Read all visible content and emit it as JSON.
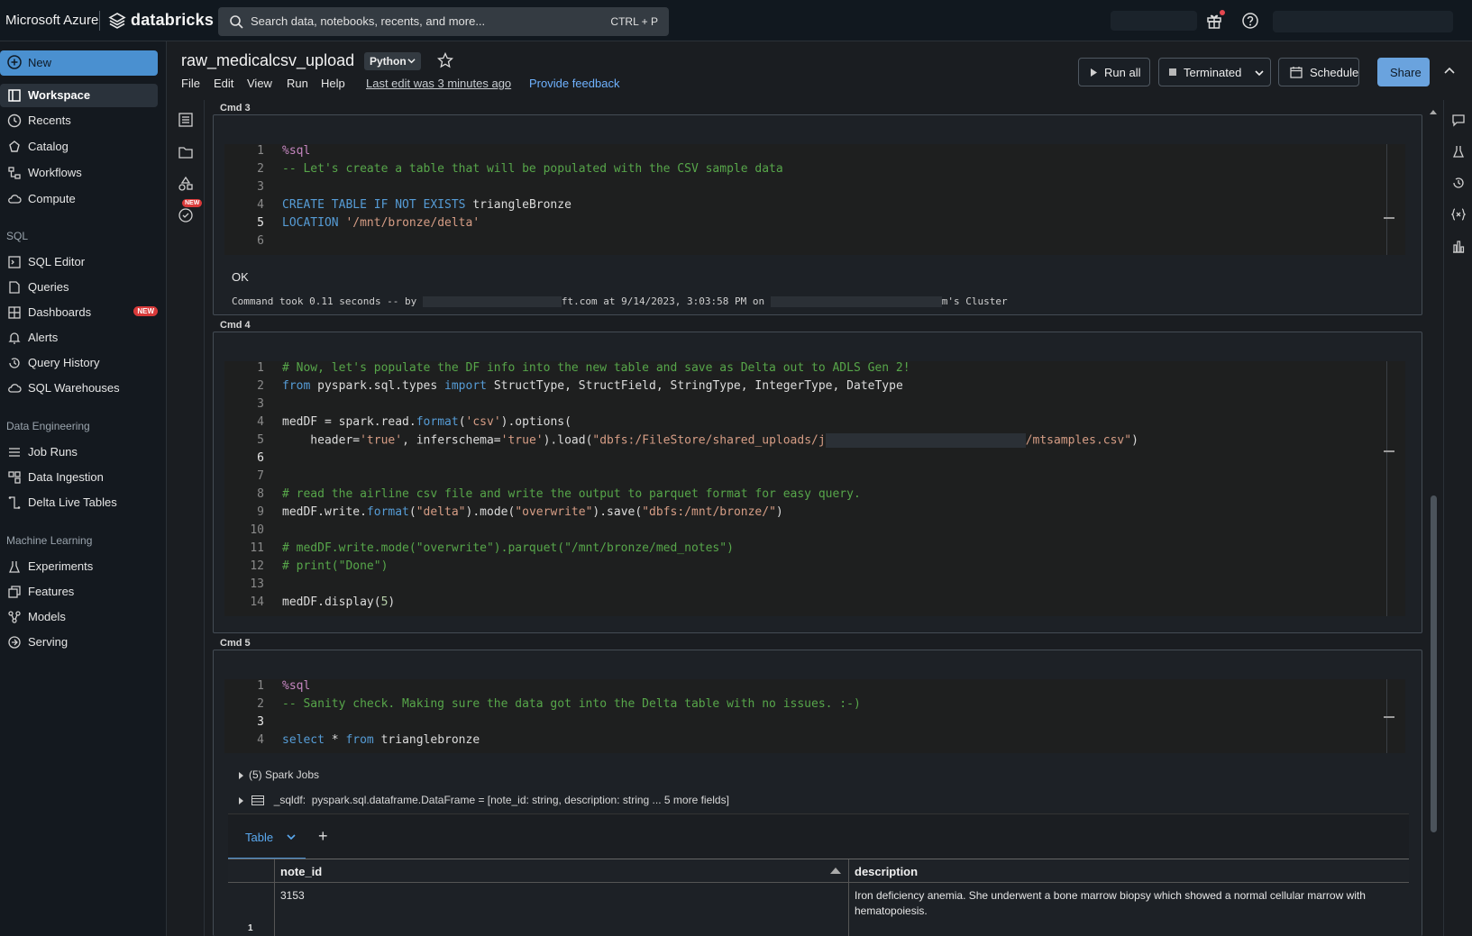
{
  "topbar": {
    "ms_brand": "Microsoft Azure",
    "db_brand": "databricks",
    "search_placeholder": "Search data, notebooks, recents, and more...",
    "search_shortcut": "CTRL + P"
  },
  "sidebar": {
    "new_label": "New",
    "items_main": [
      "Workspace",
      "Recents",
      "Catalog",
      "Workflows",
      "Compute"
    ],
    "sql_heading": "SQL",
    "sql_items": [
      "SQL Editor",
      "Queries",
      "Dashboards",
      "Alerts",
      "Query History",
      "SQL Warehouses"
    ],
    "new_badge": "NEW",
    "de_heading": "Data Engineering",
    "de_items": [
      "Job Runs",
      "Data Ingestion",
      "Delta Live Tables"
    ],
    "ml_heading": "Machine Learning",
    "ml_items": [
      "Experiments",
      "Features",
      "Models",
      "Serving"
    ]
  },
  "notebook": {
    "title": "raw_medicalcsv_upload",
    "language": "Python",
    "menu": [
      "File",
      "Edit",
      "View",
      "Run",
      "Help"
    ],
    "last_edit": "Last edit was 3 minutes ago",
    "feedback": "Provide feedback",
    "run_all": "Run all",
    "cluster_state": "Terminated",
    "schedule": "Schedule",
    "share": "Share",
    "rail_new_badge": "NEW"
  },
  "cells": {
    "cmd3": {
      "label": "Cmd 3",
      "output_ok": "OK",
      "timing_prefix": "Command took 0.11 seconds -- by ",
      "timing_mid": "ft.com at 9/14/2023, 3:03:58 PM on ",
      "timing_suffix": "m's Cluster"
    },
    "cmd4": {
      "label": "Cmd 4"
    },
    "cmd5": {
      "label": "Cmd 5",
      "spark_jobs": "(5) Spark Jobs",
      "sqldf_name": "_sqldf:",
      "sqldf_type": "pyspark.sql.dataframe.DataFrame = [note_id: string, description: string ... 5 more fields]",
      "tab_label": "Table",
      "tab_add": "+"
    }
  },
  "result_table": {
    "columns": [
      "note_id",
      "description"
    ],
    "rows": [
      {
        "index": "1",
        "note_id": "3153",
        "description": "Iron deficiency anemia.  She underwent a bone marrow biopsy which showed a normal cellular marrow with hematopoiesis."
      }
    ]
  },
  "colors": {
    "accent": "#4a90d0",
    "comment": "#57a64a",
    "keyword": "#569cd6",
    "string": "#d69d85",
    "badge_red": "#d93a3a"
  }
}
